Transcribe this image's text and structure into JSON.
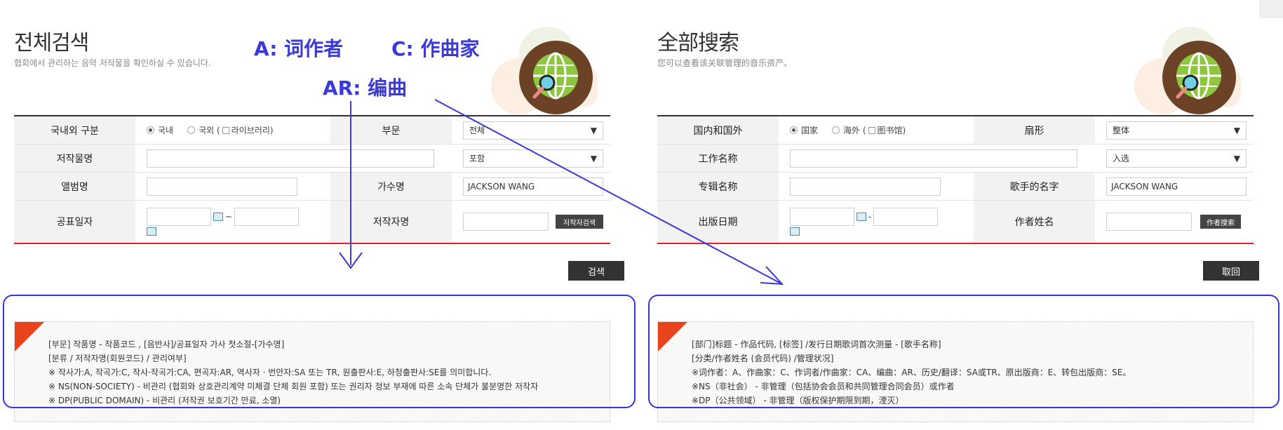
{
  "left": {
    "title": "전체검색",
    "subtitle": "협회에서 관리하는 음악 저작물을 확인하실 수 있습니다.",
    "row1": {
      "label": "국내외 구분",
      "opt_domestic": "국내",
      "opt_foreign": "국외 (",
      "opt_library": "라이브러리)",
      "label2": "부문",
      "select": "전체"
    },
    "row2": {
      "label": "저작물명",
      "select": "포함"
    },
    "row3": {
      "label": "앨범명",
      "label2": "가수명",
      "singer_value": "JACKSON WANG"
    },
    "row4": {
      "label": "공표일자",
      "tilde": "~",
      "label2": "저작자명",
      "author_btn": "저작자검색"
    },
    "search_btn": "검색",
    "notes": [
      "[부문] 작품명 - 작품코드 , [음반사]/공표일자 가사 첫소절-[가수명]",
      "[분류 / 저작자명(회원코드) / 관리여부]",
      "※ 작사가:A, 작곡가:C, 작사·작곡가:CA, 편곡자:AR, 역사자 · 번안자:SA 또는 TR, 원출판사:E, 하청출판사:SE를 의미합니다.",
      "※ NS(NON-SOCIETY) - 비관리 (협회와 상호관리계약 미체결 단체 회원 포함) 또는 권리자 정보 부재에 따른 소속 단체가 불분명한 저작자",
      "※ DP(PUBLIC DOMAIN) - 비관리 (저작권 보호기간 만료, 소멸)"
    ]
  },
  "right": {
    "title": "全部搜索",
    "subtitle": "您可以查看该关联管理的音乐资产。",
    "row1": {
      "label": "国内和国外",
      "opt_domestic": "国家",
      "opt_foreign": "海外 (",
      "opt_library": "图书馆)",
      "label2": "扇形",
      "select": "整体"
    },
    "row2": {
      "label": "工作名称",
      "select": "入选"
    },
    "row3": {
      "label": "专辑名称",
      "label2": "歌手的名字",
      "singer_value": "JACKSON WANG"
    },
    "row4": {
      "label": "出版日期",
      "tilde": "-",
      "label2": "作者姓名",
      "author_btn": "作者搜索"
    },
    "search_btn": "取回",
    "notes": [
      "[部门]标题 - 作品代码, [标签] /发行日期歌词首次测量 - [歌手名称]",
      "[分类/作者姓名 (会员代码) /管理状况]",
      "※词作者：A、作曲家：C、作词者/作曲家：CA、编曲：AR、历史/翻译：SA或TR、原出版商：E、转包出版商：SE。",
      "※NS（非社会） - 非管理（包括协会会员和共同管理合同会员）或作者",
      "※DP（公共领域） - 非管理（版权保护期限到期，湮灭）"
    ]
  },
  "annotations": {
    "a": "A: 词作者",
    "c": "C: 作曲家",
    "ar": "AR: 编曲"
  },
  "icons": {
    "dropdown": "triangle-down-icon",
    "calendar": "calendar-icon",
    "globe": "globe-search-icon"
  },
  "colors": {
    "accent_red": "#e0242b",
    "annotation_blue": "#3a3ad6",
    "corner": "#e8431c",
    "globe_brown": "#6b4226",
    "globe_green": "#8dc63f"
  }
}
